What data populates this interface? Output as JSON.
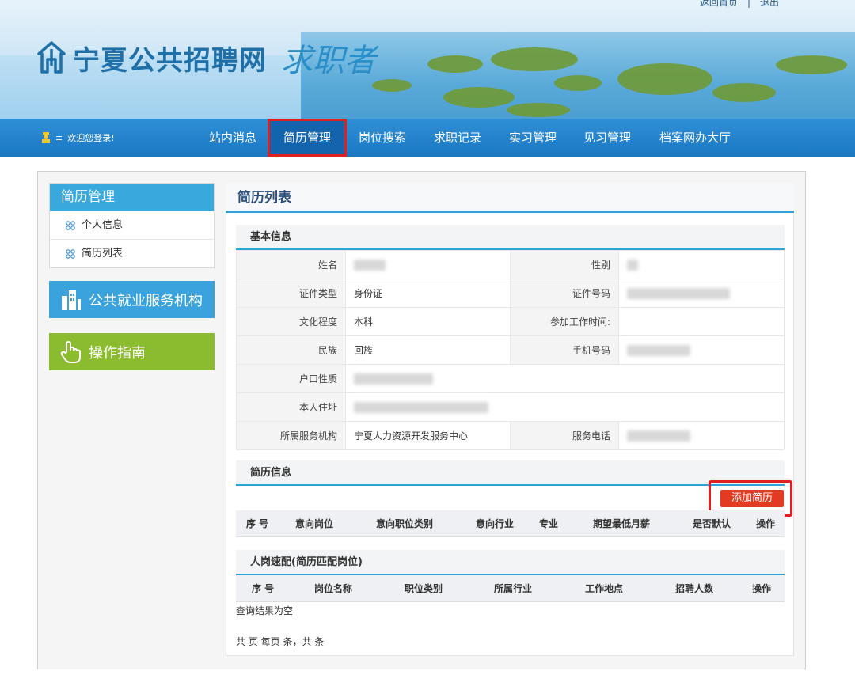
{
  "header": {
    "top_links": [
      "返回首页",
      "|",
      "退出"
    ],
    "site_title": "宁夏公共招聘网",
    "site_subtitle": "求职者"
  },
  "nav": {
    "welcome": "欢迎您登录!",
    "items": [
      {
        "label": "站内消息",
        "active": false
      },
      {
        "label": "简历管理",
        "active": true
      },
      {
        "label": "岗位搜索",
        "active": false
      },
      {
        "label": "求职记录",
        "active": false
      },
      {
        "label": "实习管理",
        "active": false
      },
      {
        "label": "见习管理",
        "active": false
      },
      {
        "label": "档案网办大厅",
        "active": false
      }
    ]
  },
  "sidebar": {
    "heading": "简历管理",
    "links": [
      "个人信息",
      "简历列表"
    ],
    "cards": [
      "公共就业服务机构",
      "操作指南"
    ]
  },
  "main": {
    "title": "简历列表",
    "basic": {
      "heading": "基本信息",
      "name_label": "姓名",
      "gender_label": "性别",
      "id_type_label": "证件类型",
      "id_type_value": "身份证",
      "id_no_label": "证件号码",
      "edu_label": "文化程度",
      "edu_value": "本科",
      "work_start_label": "参加工作时间:",
      "ethnic_label": "民族",
      "ethnic_value": "回族",
      "phone_label": "手机号码",
      "hukou_label": "户口性质",
      "address_label": "本人住址",
      "agency_label": "所属服务机构",
      "agency_value": "宁夏人力资源开发服务中心",
      "service_phone_label": "服务电话"
    },
    "resume": {
      "heading": "简历信息",
      "add_button": "添加简历",
      "columns": [
        "序 号",
        "意向岗位",
        "意向职位类别",
        "意向行业",
        "专业",
        "期望最低月薪",
        "是否默认",
        "操作"
      ]
    },
    "match": {
      "heading": "人岗速配(简历匹配岗位)",
      "columns": [
        "序 号",
        "岗位名称",
        "职位类别",
        "所属行业",
        "工作地点",
        "招聘人数",
        "操作"
      ],
      "empty_text": "查询结果为空",
      "pager_text": "共 页 每页 条，共 条"
    }
  },
  "colors": {
    "nav_blue": "#1a78c3",
    "accent_blue": "#2fa3d8",
    "highlight_red": "#e02020",
    "add_button_red": "#e23b22",
    "card_green": "#8bbb2f"
  }
}
